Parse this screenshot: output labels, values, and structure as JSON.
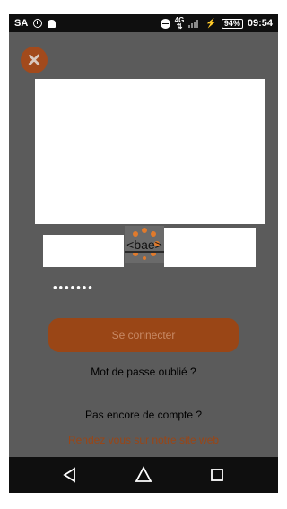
{
  "status_bar": {
    "sa_label": "SA",
    "network_type": "4G",
    "battery": "94",
    "battery_unit": "%",
    "time": "09:54",
    "icons": [
      "clock-icon",
      "android-icon",
      "do-not-disturb-icon",
      "signal-icon",
      "charging-icon",
      "battery-icon"
    ]
  },
  "logo": {
    "text": "<bae>"
  },
  "login": {
    "password_value": "•••••••",
    "submit_label": "Se connecter",
    "forgot_password": "Mot de passe oublié ?",
    "no_account": "Pas encore de compte ?",
    "website_link": "Rendez vous sur notre site web"
  },
  "colors": {
    "accent": "#9a4616",
    "overlay": "#5b5b5b"
  }
}
